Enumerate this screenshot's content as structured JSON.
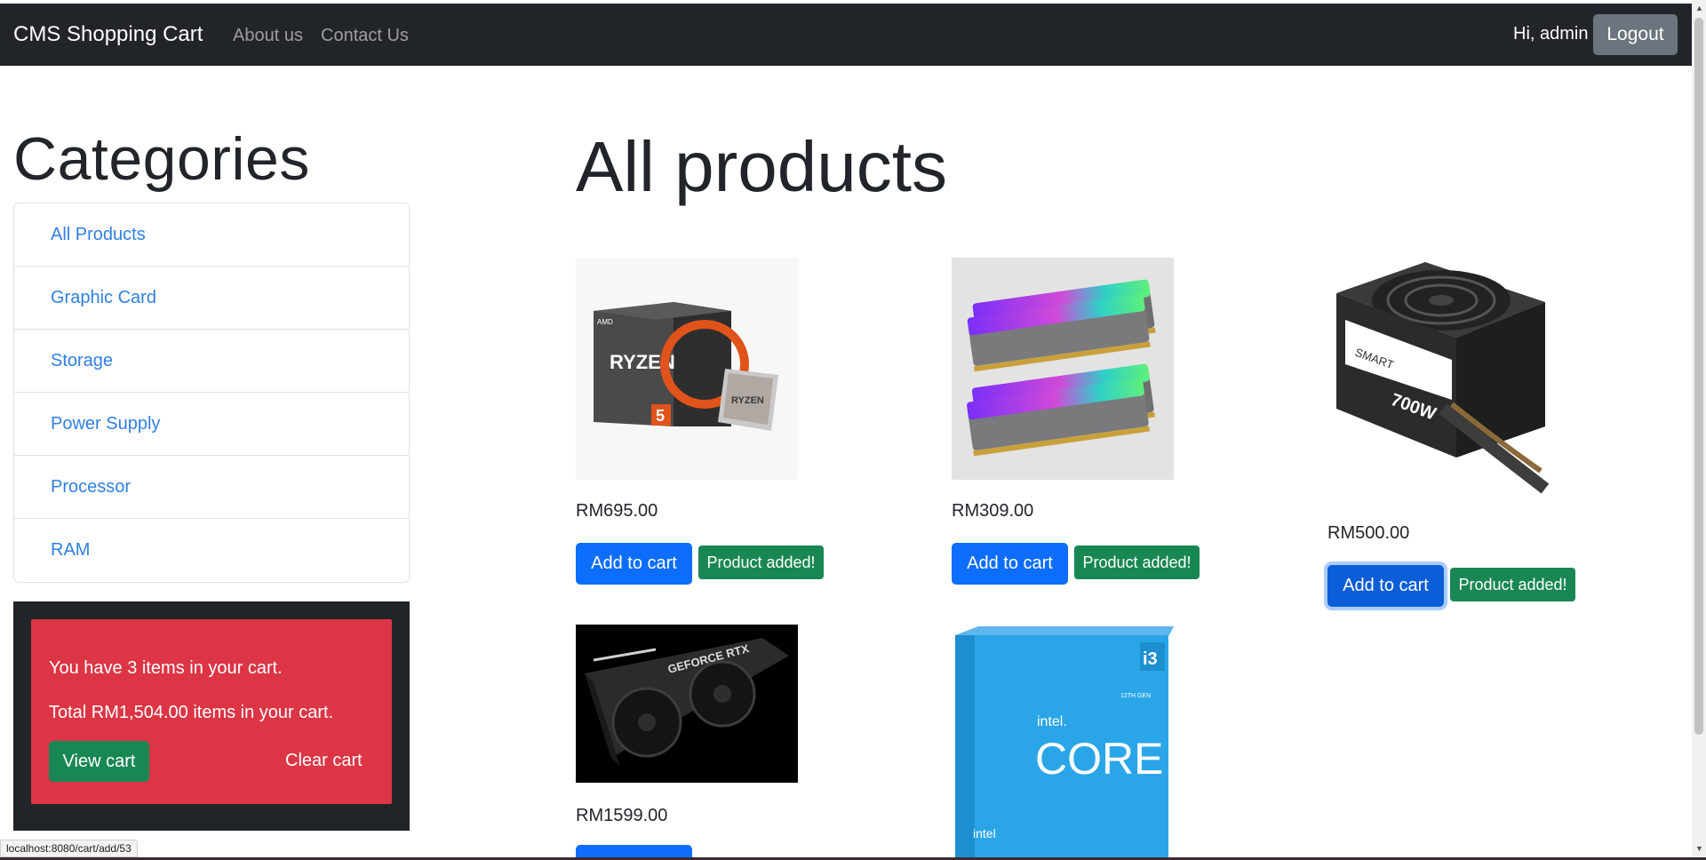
{
  "navbar": {
    "brand": "CMS Shopping Cart",
    "links": [
      "About us",
      "Contact Us"
    ],
    "greeting": "Hi, admin",
    "logout_label": "Logout"
  },
  "sidebar": {
    "title": "Categories",
    "categories": [
      "All Products",
      "Graphic Card",
      "Storage",
      "Power Supply",
      "Processor",
      "RAM"
    ],
    "cart": {
      "items_text": "You have 3 items in your cart.",
      "total_text": "Total RM1,504.00 items in your cart.",
      "view_cart_label": "View cart",
      "clear_cart_label": "Clear cart"
    }
  },
  "main": {
    "title": "All products",
    "add_to_cart_label": "Add to cart",
    "added_badge_text": "Product added!",
    "products": [
      {
        "price": "RM695.00",
        "image": "amd-ryzen-5-processor",
        "added": true
      },
      {
        "price": "RM309.00",
        "image": "rgb-ram-sticks",
        "added": true
      },
      {
        "price": "RM500.00",
        "image": "700w-power-supply",
        "added": true
      },
      {
        "price": "RM1599.00",
        "image": "geforce-rtx-graphic-card",
        "added": false
      },
      {
        "price": "",
        "image": "intel-core-i3-processor",
        "added": false
      }
    ]
  },
  "status_bar": {
    "url": "localhost:8080/cart/add/53"
  },
  "colors": {
    "navbar_bg": "#212529",
    "primary": "#0d6efd",
    "success": "#198754",
    "danger": "#dc3545",
    "link": "#2f7fe3",
    "secondary": "#6c757d"
  }
}
